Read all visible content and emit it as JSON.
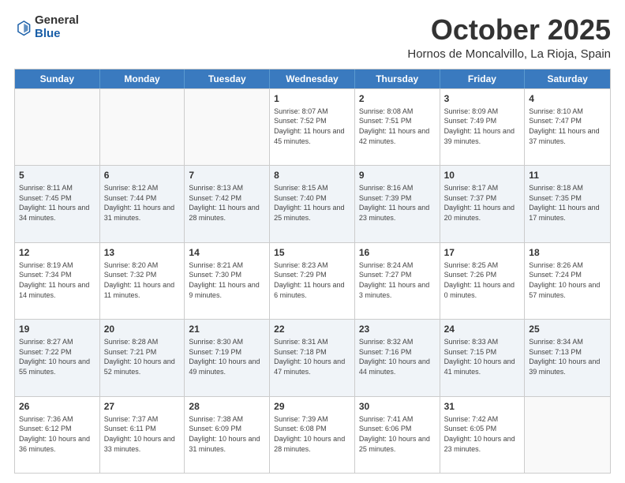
{
  "header": {
    "logo": {
      "line1": "General",
      "line2": "Blue"
    },
    "month": "October 2025",
    "location": "Hornos de Moncalvillo, La Rioja, Spain"
  },
  "days": [
    "Sunday",
    "Monday",
    "Tuesday",
    "Wednesday",
    "Thursday",
    "Friday",
    "Saturday"
  ],
  "rows": [
    {
      "cells": [
        {
          "day": "",
          "empty": true
        },
        {
          "day": "",
          "empty": true
        },
        {
          "day": "",
          "empty": true
        },
        {
          "day": "1",
          "sunrise": "8:07 AM",
          "sunset": "7:52 PM",
          "daylight": "11 hours and 45 minutes."
        },
        {
          "day": "2",
          "sunrise": "8:08 AM",
          "sunset": "7:51 PM",
          "daylight": "11 hours and 42 minutes."
        },
        {
          "day": "3",
          "sunrise": "8:09 AM",
          "sunset": "7:49 PM",
          "daylight": "11 hours and 39 minutes."
        },
        {
          "day": "4",
          "sunrise": "8:10 AM",
          "sunset": "7:47 PM",
          "daylight": "11 hours and 37 minutes."
        }
      ],
      "shade": false
    },
    {
      "cells": [
        {
          "day": "5",
          "sunrise": "8:11 AM",
          "sunset": "7:45 PM",
          "daylight": "11 hours and 34 minutes."
        },
        {
          "day": "6",
          "sunrise": "8:12 AM",
          "sunset": "7:44 PM",
          "daylight": "11 hours and 31 minutes."
        },
        {
          "day": "7",
          "sunrise": "8:13 AM",
          "sunset": "7:42 PM",
          "daylight": "11 hours and 28 minutes."
        },
        {
          "day": "8",
          "sunrise": "8:15 AM",
          "sunset": "7:40 PM",
          "daylight": "11 hours and 25 minutes."
        },
        {
          "day": "9",
          "sunrise": "8:16 AM",
          "sunset": "7:39 PM",
          "daylight": "11 hours and 23 minutes."
        },
        {
          "day": "10",
          "sunrise": "8:17 AM",
          "sunset": "7:37 PM",
          "daylight": "11 hours and 20 minutes."
        },
        {
          "day": "11",
          "sunrise": "8:18 AM",
          "sunset": "7:35 PM",
          "daylight": "11 hours and 17 minutes."
        }
      ],
      "shade": true
    },
    {
      "cells": [
        {
          "day": "12",
          "sunrise": "8:19 AM",
          "sunset": "7:34 PM",
          "daylight": "11 hours and 14 minutes."
        },
        {
          "day": "13",
          "sunrise": "8:20 AM",
          "sunset": "7:32 PM",
          "daylight": "11 hours and 11 minutes."
        },
        {
          "day": "14",
          "sunrise": "8:21 AM",
          "sunset": "7:30 PM",
          "daylight": "11 hours and 9 minutes."
        },
        {
          "day": "15",
          "sunrise": "8:23 AM",
          "sunset": "7:29 PM",
          "daylight": "11 hours and 6 minutes."
        },
        {
          "day": "16",
          "sunrise": "8:24 AM",
          "sunset": "7:27 PM",
          "daylight": "11 hours and 3 minutes."
        },
        {
          "day": "17",
          "sunrise": "8:25 AM",
          "sunset": "7:26 PM",
          "daylight": "11 hours and 0 minutes."
        },
        {
          "day": "18",
          "sunrise": "8:26 AM",
          "sunset": "7:24 PM",
          "daylight": "10 hours and 57 minutes."
        }
      ],
      "shade": false
    },
    {
      "cells": [
        {
          "day": "19",
          "sunrise": "8:27 AM",
          "sunset": "7:22 PM",
          "daylight": "10 hours and 55 minutes."
        },
        {
          "day": "20",
          "sunrise": "8:28 AM",
          "sunset": "7:21 PM",
          "daylight": "10 hours and 52 minutes."
        },
        {
          "day": "21",
          "sunrise": "8:30 AM",
          "sunset": "7:19 PM",
          "daylight": "10 hours and 49 minutes."
        },
        {
          "day": "22",
          "sunrise": "8:31 AM",
          "sunset": "7:18 PM",
          "daylight": "10 hours and 47 minutes."
        },
        {
          "day": "23",
          "sunrise": "8:32 AM",
          "sunset": "7:16 PM",
          "daylight": "10 hours and 44 minutes."
        },
        {
          "day": "24",
          "sunrise": "8:33 AM",
          "sunset": "7:15 PM",
          "daylight": "10 hours and 41 minutes."
        },
        {
          "day": "25",
          "sunrise": "8:34 AM",
          "sunset": "7:13 PM",
          "daylight": "10 hours and 39 minutes."
        }
      ],
      "shade": true
    },
    {
      "cells": [
        {
          "day": "26",
          "sunrise": "7:36 AM",
          "sunset": "6:12 PM",
          "daylight": "10 hours and 36 minutes."
        },
        {
          "day": "27",
          "sunrise": "7:37 AM",
          "sunset": "6:11 PM",
          "daylight": "10 hours and 33 minutes."
        },
        {
          "day": "28",
          "sunrise": "7:38 AM",
          "sunset": "6:09 PM",
          "daylight": "10 hours and 31 minutes."
        },
        {
          "day": "29",
          "sunrise": "7:39 AM",
          "sunset": "6:08 PM",
          "daylight": "10 hours and 28 minutes."
        },
        {
          "day": "30",
          "sunrise": "7:41 AM",
          "sunset": "6:06 PM",
          "daylight": "10 hours and 25 minutes."
        },
        {
          "day": "31",
          "sunrise": "7:42 AM",
          "sunset": "6:05 PM",
          "daylight": "10 hours and 23 minutes."
        },
        {
          "day": "",
          "empty": true
        }
      ],
      "shade": false
    }
  ]
}
